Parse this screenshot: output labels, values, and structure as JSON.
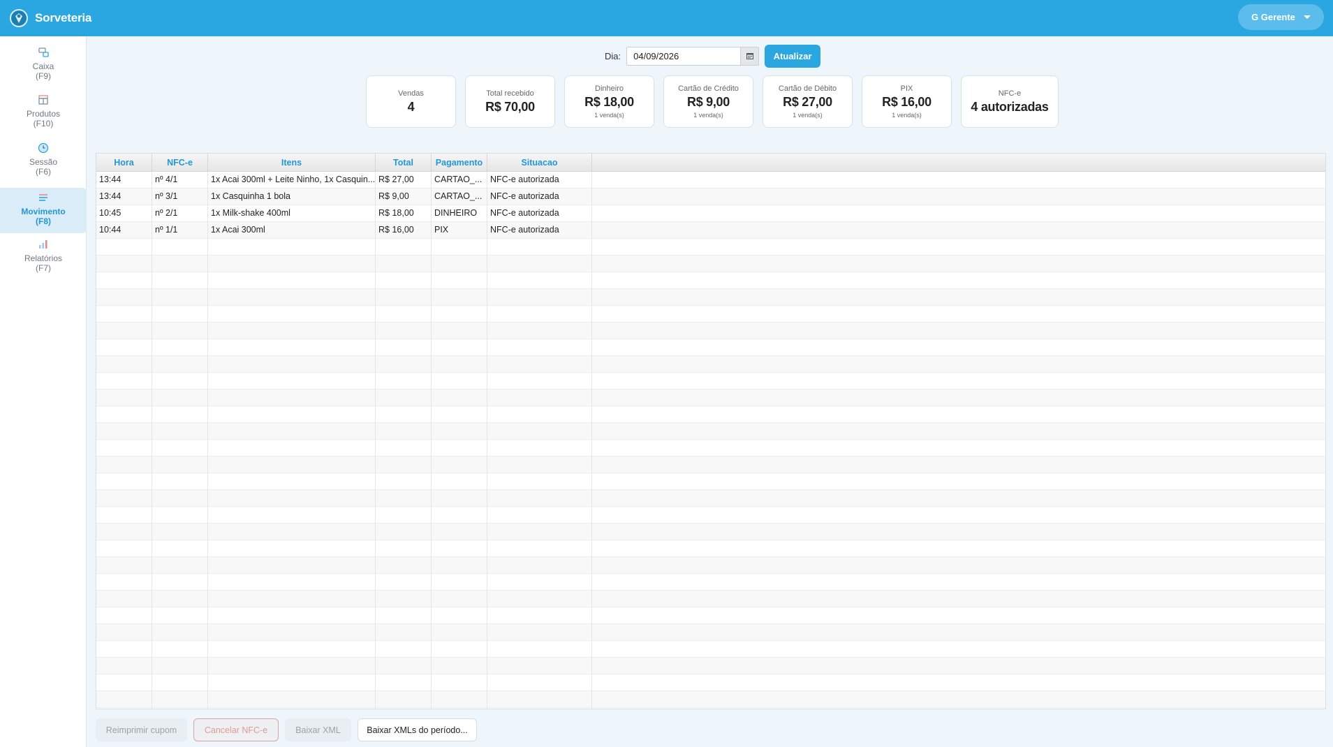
{
  "app": {
    "title": "Sorveteria",
    "user_label": "G Gerente"
  },
  "sidebar": {
    "items": [
      {
        "label": "Caixa",
        "shortcut": "(F9)",
        "icon": "cash-register-icon",
        "active": false
      },
      {
        "label": "Produtos",
        "shortcut": "(F10)",
        "icon": "products-icon",
        "active": false
      },
      {
        "label": "Sessão",
        "shortcut": "(F6)",
        "icon": "clock-icon",
        "active": false
      },
      {
        "label": "Movimento",
        "shortcut": "(F8)",
        "icon": "list-icon",
        "active": true
      },
      {
        "label": "Relatórios",
        "shortcut": "(F7)",
        "icon": "bar-chart-icon",
        "active": false
      }
    ]
  },
  "filter": {
    "label": "Dia:",
    "date_value": "04/09/2026",
    "refresh_label": "Atualizar"
  },
  "cards": [
    {
      "label": "Vendas",
      "value": "4",
      "sub": ""
    },
    {
      "label": "Total recebido",
      "value": "R$ 70,00",
      "sub": ""
    },
    {
      "label": "Dinheiro",
      "value": "R$ 18,00",
      "sub": "1 venda(s)"
    },
    {
      "label": "Cartão de Crédito",
      "value": "R$ 9,00",
      "sub": "1 venda(s)"
    },
    {
      "label": "Cartão de Débito",
      "value": "R$ 27,00",
      "sub": "1 venda(s)"
    },
    {
      "label": "PIX",
      "value": "R$ 16,00",
      "sub": "1 venda(s)"
    },
    {
      "label": "NFC-e",
      "value": "4 autorizadas",
      "sub": ""
    }
  ],
  "table": {
    "columns": [
      "Hora",
      "NFC-e",
      "Itens",
      "Total",
      "Pagamento",
      "Situacao"
    ],
    "rows": [
      [
        "13:44",
        "nº 4/1",
        "1x Acai 300ml + Leite Ninho, 1x Casquin...",
        "R$ 27,00",
        "CARTAO_...",
        "NFC-e autorizada"
      ],
      [
        "13:44",
        "nº 3/1",
        "1x Casquinha 1 bola",
        "R$ 9,00",
        "CARTAO_...",
        "NFC-e autorizada"
      ],
      [
        "10:45",
        "nº 2/1",
        "1x Milk-shake 400ml",
        "R$ 18,00",
        "DINHEIRO",
        "NFC-e autorizada"
      ],
      [
        "10:44",
        "nº 1/1",
        "1x Acai 300ml",
        "R$ 16,00",
        "PIX",
        "NFC-e autorizada"
      ]
    ]
  },
  "actions": {
    "reprint": "Reimprimir cupom",
    "cancel": "Cancelar NFC-e",
    "download_xml": "Baixar XML",
    "download_period": "Baixar XMLs do período..."
  },
  "colors": {
    "accent": "#2aa6e1",
    "header": "#2aa6e1",
    "active_nav": "#2596d4"
  }
}
